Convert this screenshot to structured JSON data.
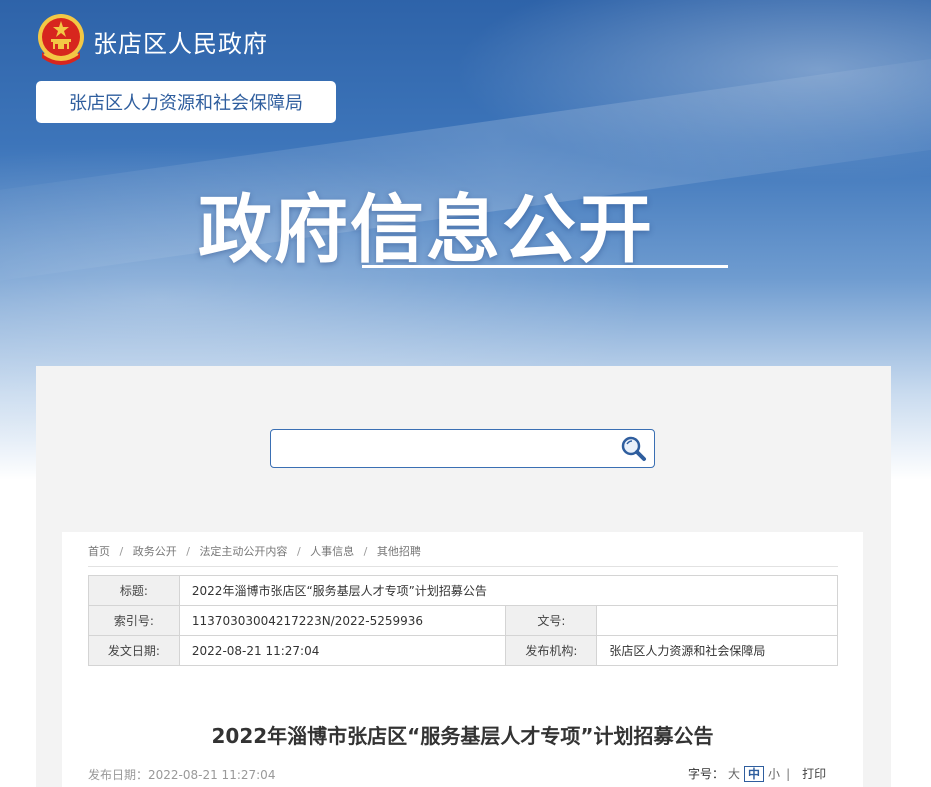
{
  "header": {
    "site_name": "张店区人民政府",
    "department": "张店区人力资源和社会保障局",
    "banner_title": "政府信息公开",
    "emblem_icon": "national-emblem-icon"
  },
  "search": {
    "placeholder": "",
    "value": "",
    "icon": "search-icon"
  },
  "breadcrumb": {
    "items": [
      "首页",
      "政务公开",
      "法定主动公开内容",
      "人事信息",
      "其他招聘"
    ],
    "separator": "/"
  },
  "meta": {
    "title_label": "标题:",
    "title_value": "2022年淄博市张店区“服务基层人才专项”计划招募公告",
    "index_label": "索引号:",
    "index_value": "11370303004217223N/2022-5259936",
    "docno_label": "文号:",
    "docno_value": "",
    "date_label": "发文日期:",
    "date_value": "2022-08-21 11:27:04",
    "org_label": "发布机构:",
    "org_value": "张店区人力资源和社会保障局"
  },
  "article": {
    "title": "2022年淄博市张店区“服务基层人才专项”计划招募公告",
    "pub_date": "发布日期：2022-08-21 11:27:04"
  },
  "font_size": {
    "label": "字号：",
    "large": "大",
    "medium": "中",
    "small": "小",
    "separator": "|",
    "print": "打印",
    "selected": "中"
  },
  "colors": {
    "brand_blue": "#2f5e9e",
    "emblem_red": "#d7261e",
    "emblem_gold": "#f3c845"
  }
}
